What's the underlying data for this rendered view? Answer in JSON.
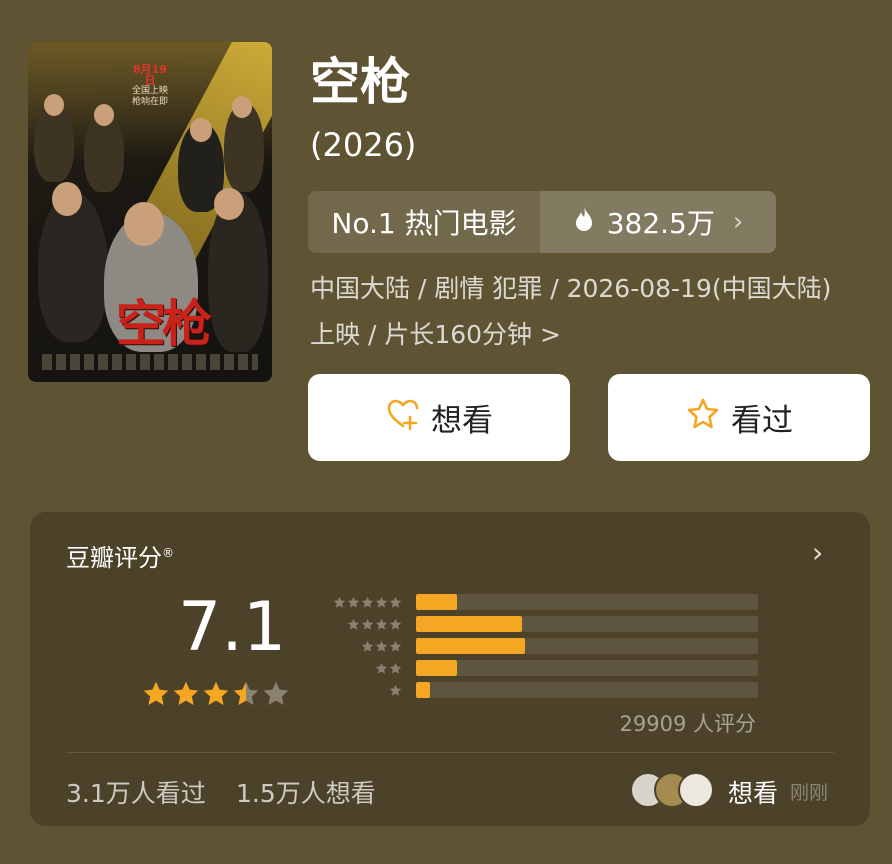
{
  "movie": {
    "title": "空枪",
    "year": "(2026)",
    "rank_label": "No.1 热门电影",
    "heat_value": "382.5万",
    "meta_line1": "中国大陆 / 剧情 犯罪 / 2026-08-19(中国大陆)",
    "meta_line2": "上映 / 片长160分钟 >",
    "poster": {
      "release_date": "8月19日",
      "release_line2": "全国上映",
      "release_line3": "枪响在即",
      "title_text": "空枪"
    }
  },
  "actions": {
    "want_label": "想看",
    "seen_label": "看过"
  },
  "rating": {
    "header": "豆瓣评分",
    "registered_mark": "®",
    "score": "7.1",
    "stars_value": 3.5,
    "stars_max": 5,
    "distribution": [
      {
        "stars": 5,
        "fraction": 0.12
      },
      {
        "stars": 4,
        "fraction": 0.31
      },
      {
        "stars": 3,
        "fraction": 0.32
      },
      {
        "stars": 2,
        "fraction": 0.12
      },
      {
        "stars": 1,
        "fraction": 0.04
      }
    ],
    "votes_text": "29909 人评分",
    "seen_text": "3.1万人看过",
    "want_text": "1.5万人想看",
    "activity_action": "想看",
    "activity_time": "刚刚"
  },
  "colors": {
    "accent": "#f5a623",
    "star_empty": "#8a8170",
    "background": "#5e5332",
    "card": "#4b4229"
  },
  "icons": {
    "heat": "flame-icon",
    "want": "heart-plus-icon",
    "seen": "star-outline-icon",
    "chevron": "chevron-right-icon"
  }
}
